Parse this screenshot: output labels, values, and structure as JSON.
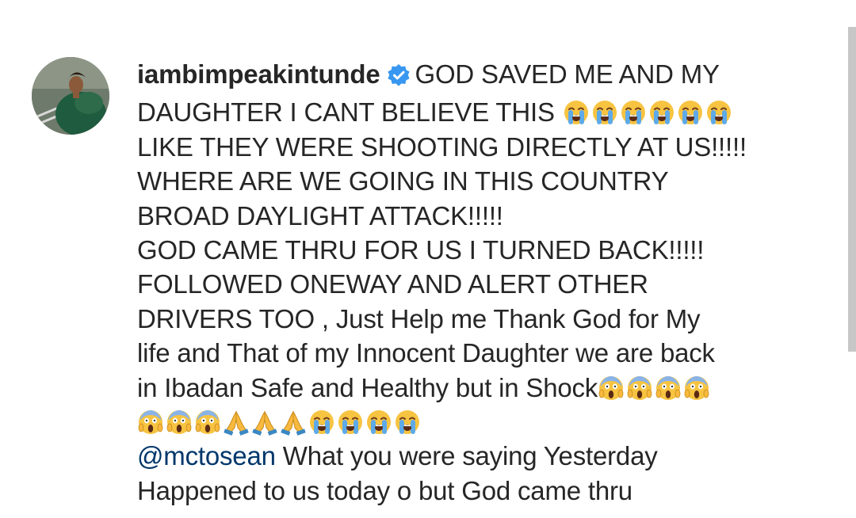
{
  "post": {
    "username": "iambimpeakintunde",
    "verified": true,
    "avatar_icon": "profile-photo",
    "lines": [
      {
        "prefix": "GOD SAVED ME AND MY"
      },
      {
        "text": "DAUGHTER I CANT BELIEVE THIS",
        "emoji": [
          "loudly-crying-face",
          "loudly-crying-face",
          "loudly-crying-face",
          "loudly-crying-face",
          "loudly-crying-face",
          "loudly-crying-face"
        ]
      },
      {
        "text": "LIKE THEY WERE SHOOTING DIRECTLY AT US!!!!!"
      },
      {
        "text": "WHERE ARE WE GOING IN THIS  COUNTRY"
      },
      {
        "text": "BROAD DAYLIGHT ATTACK!!!!!"
      },
      {
        "text": "GOD CAME THRU FOR US I TURNED BACK!!!!!"
      },
      {
        "text": "FOLLOWED ONEWAY AND ALERT OTHER"
      },
      {
        "text": "DRIVERS TOO , Just Help me Thank God for My"
      },
      {
        "text": "life and That of my Innocent Daughter we are back"
      },
      {
        "text": "in Ibadan Safe and Healthy but in Shock",
        "emoji": [
          "face-screaming-in-fear",
          "face-screaming-in-fear",
          "face-screaming-in-fear",
          "face-screaming-in-fear"
        ]
      },
      {
        "text": "",
        "emoji": [
          "face-screaming-in-fear",
          "face-screaming-in-fear",
          "face-screaming-in-fear",
          "folded-hands",
          "folded-hands",
          "folded-hands",
          "loudly-crying-face",
          "loudly-crying-face",
          "loudly-crying-face",
          "loudly-crying-face"
        ]
      }
    ],
    "mention": "@mctosean",
    "mention_text": " What you were saying Yesterday",
    "last_line": "Happened to us today o but God came thru"
  },
  "colors": {
    "text": "#262626",
    "mention": "#00376b",
    "verified": "#3897f0",
    "scrollbar": "#c7c7c7"
  }
}
